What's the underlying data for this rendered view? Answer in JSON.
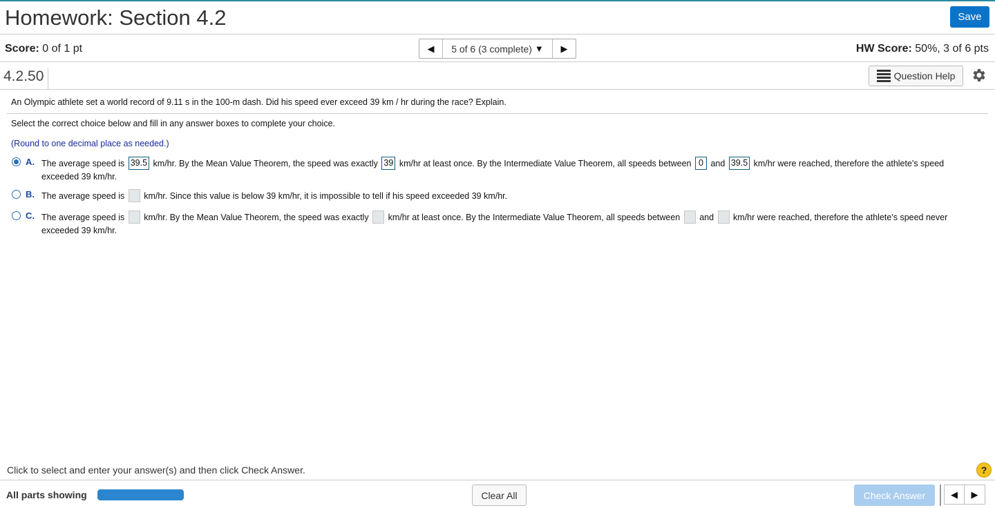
{
  "header": {
    "title": "Homework: Section 4.2",
    "save_label": "Save"
  },
  "score": {
    "label": "Score:",
    "value": "0 of 1 pt"
  },
  "hw_score": {
    "label": "HW Score:",
    "value": "50%, 3 of 6 pts"
  },
  "question_nav": {
    "position": "5 of 6 (3 complete)",
    "prev_icon": "◀",
    "next_icon": "▶",
    "dropdown_icon": "▼"
  },
  "question": {
    "number": "4.2.50",
    "help_label": "Question Help",
    "prompt": "An Olympic athlete set a world record of 9.11 s in the 100-m dash. Did his speed ever exceed 39 km / hr during the race? Explain.",
    "instruction": "Select the correct choice below and fill in any answer boxes to complete your choice.",
    "rounding": "(Round to one decimal place as needed.)"
  },
  "choices": {
    "a": {
      "label": "A.",
      "selected": true,
      "t1": "The average speed is",
      "v1": "39.5",
      "t2": "km/hr. By the Mean Value Theorem, the speed was exactly",
      "v2": "39",
      "t3": "km/hr at least once. By the Intermediate Value Theorem, all speeds between",
      "v3": "0",
      "t4": "and",
      "v4": "39.5",
      "t5": "km/hr were reached, therefore the athlete's speed exceeded 39 km/hr."
    },
    "b": {
      "label": "B.",
      "selected": false,
      "t1": "The average speed is",
      "t2": "km/hr. Since this value is below 39 km/hr, it is impossible to tell if his speed exceeded 39 km/hr."
    },
    "c": {
      "label": "C.",
      "selected": false,
      "t1": "The average speed is",
      "t2": "km/hr. By the Mean Value Theorem, the speed was exactly",
      "t3": "km/hr at least once. By the Intermediate Value Theorem, all speeds between",
      "t4": "and",
      "t5": "km/hr were reached, therefore the athlete's speed never exceeded 39 km/hr."
    }
  },
  "footer": {
    "hint": "Click to select and enter your answer(s) and then click Check Answer.",
    "help_icon": "?",
    "parts_label": "All parts showing",
    "progress_fraction": 1.0,
    "clear_label": "Clear All",
    "check_label": "Check Answer",
    "prev_icon": "◀",
    "next_icon": "▶"
  },
  "colors": {
    "accent": "#0b74c9",
    "choice_label": "#1a4ba0",
    "progress": "#2b86cf",
    "check_disabled": "#a9cdee"
  }
}
